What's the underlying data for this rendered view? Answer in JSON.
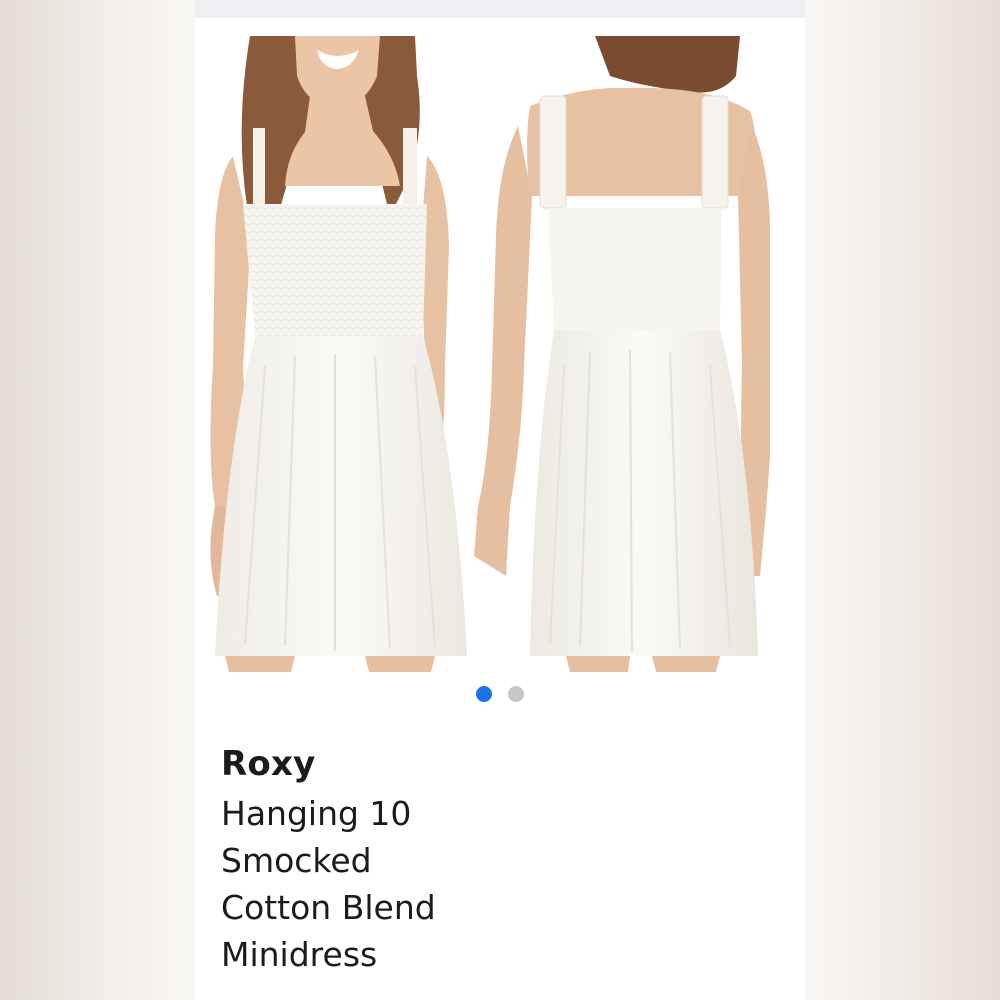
{
  "product": {
    "brand": "Roxy",
    "title_lines": [
      "Hanging 10",
      "Smocked",
      "Cotton Blend",
      "Minidress"
    ]
  },
  "gallery": {
    "images": [
      {
        "view": "front",
        "icon": "white-smocked-minidress-front"
      },
      {
        "view": "back",
        "icon": "white-smocked-minidress-back"
      }
    ],
    "active_index": 1,
    "image_count": 2
  },
  "colors": {
    "active_dot": "#1a73e8",
    "inactive_dot": "#c6c6c6",
    "dress": "#fbfaf6",
    "skin": "#e8c1a2"
  }
}
